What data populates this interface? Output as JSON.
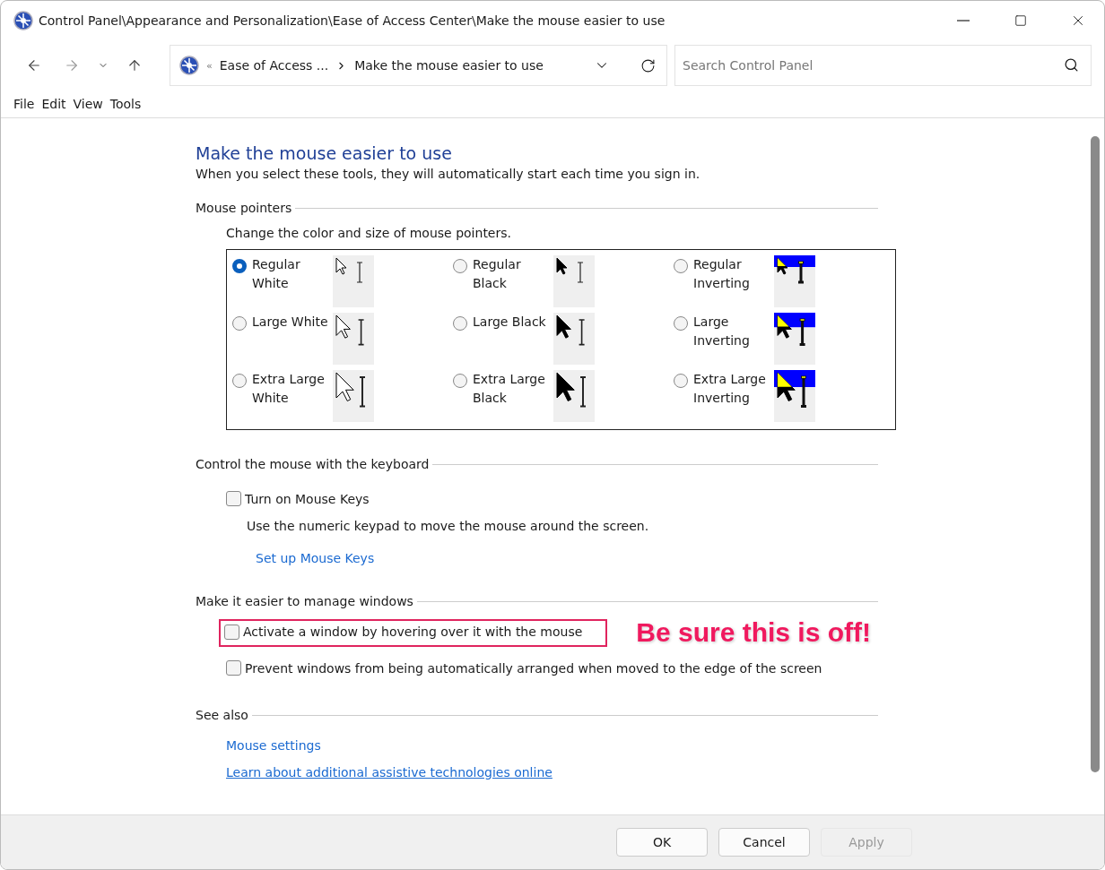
{
  "window": {
    "title": "Control Panel\\Appearance and Personalization\\Ease of Access Center\\Make the mouse easier to use"
  },
  "address_bar": {
    "overflow": "«",
    "crumbs": [
      "Ease of Access ...",
      "Make the mouse easier to use"
    ]
  },
  "search": {
    "placeholder": "Search Control Panel"
  },
  "menu": [
    "File",
    "Edit",
    "View",
    "Tools"
  ],
  "page": {
    "title": "Make the mouse easier to use",
    "subtitle": "When you select these tools, they will automatically start each time you sign in."
  },
  "pointers": {
    "heading": "Mouse pointers",
    "description": "Change the color and size of mouse pointers.",
    "options": [
      {
        "label": "Regular White",
        "selected": true,
        "kind": "white"
      },
      {
        "label": "Regular Black",
        "selected": false,
        "kind": "black"
      },
      {
        "label": "Regular Inverting",
        "selected": false,
        "kind": "inverting"
      },
      {
        "label": "Large White",
        "selected": false,
        "kind": "white"
      },
      {
        "label": "Large Black",
        "selected": false,
        "kind": "black"
      },
      {
        "label": "Large Inverting",
        "selected": false,
        "kind": "inverting"
      },
      {
        "label": "Extra Large White",
        "selected": false,
        "kind": "white"
      },
      {
        "label": "Extra Large Black",
        "selected": false,
        "kind": "black"
      },
      {
        "label": "Extra Large Inverting",
        "selected": false,
        "kind": "inverting"
      }
    ]
  },
  "keyboard": {
    "heading": "Control the mouse with the keyboard",
    "checkbox": {
      "label": "Turn on Mouse Keys",
      "checked": false
    },
    "description": "Use the numeric keypad to move the mouse around the screen.",
    "link": "Set up Mouse Keys"
  },
  "windows": {
    "heading": "Make it easier to manage windows",
    "checkboxes": [
      {
        "label": "Activate a window by hovering over it with the mouse",
        "checked": false,
        "highlighted": true,
        "note": "Be sure this is off!"
      },
      {
        "label": "Prevent windows from being automatically arranged when moved to the edge of the screen",
        "checked": false,
        "highlighted": false
      }
    ]
  },
  "see_also": {
    "heading": "See also",
    "links": [
      {
        "label": "Mouse settings",
        "underlined": false
      },
      {
        "label": "Learn about additional assistive technologies online",
        "underlined": true
      }
    ]
  },
  "buttons": [
    {
      "label": "OK",
      "disabled": false
    },
    {
      "label": "Cancel",
      "disabled": false
    },
    {
      "label": "Apply",
      "disabled": true
    }
  ]
}
